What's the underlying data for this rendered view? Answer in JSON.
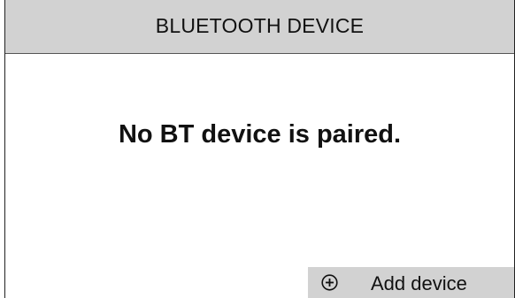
{
  "header": {
    "title": "BLUETOOTH DEVICE"
  },
  "main": {
    "message": "No BT device is paired."
  },
  "actions": {
    "add_device": {
      "icon": "plus-circle-icon",
      "label": "Add device"
    }
  },
  "colors": {
    "header_background": "#d2d2d2",
    "button_background": "#d2d2d2",
    "background": "#ffffff",
    "text": "#111111"
  }
}
